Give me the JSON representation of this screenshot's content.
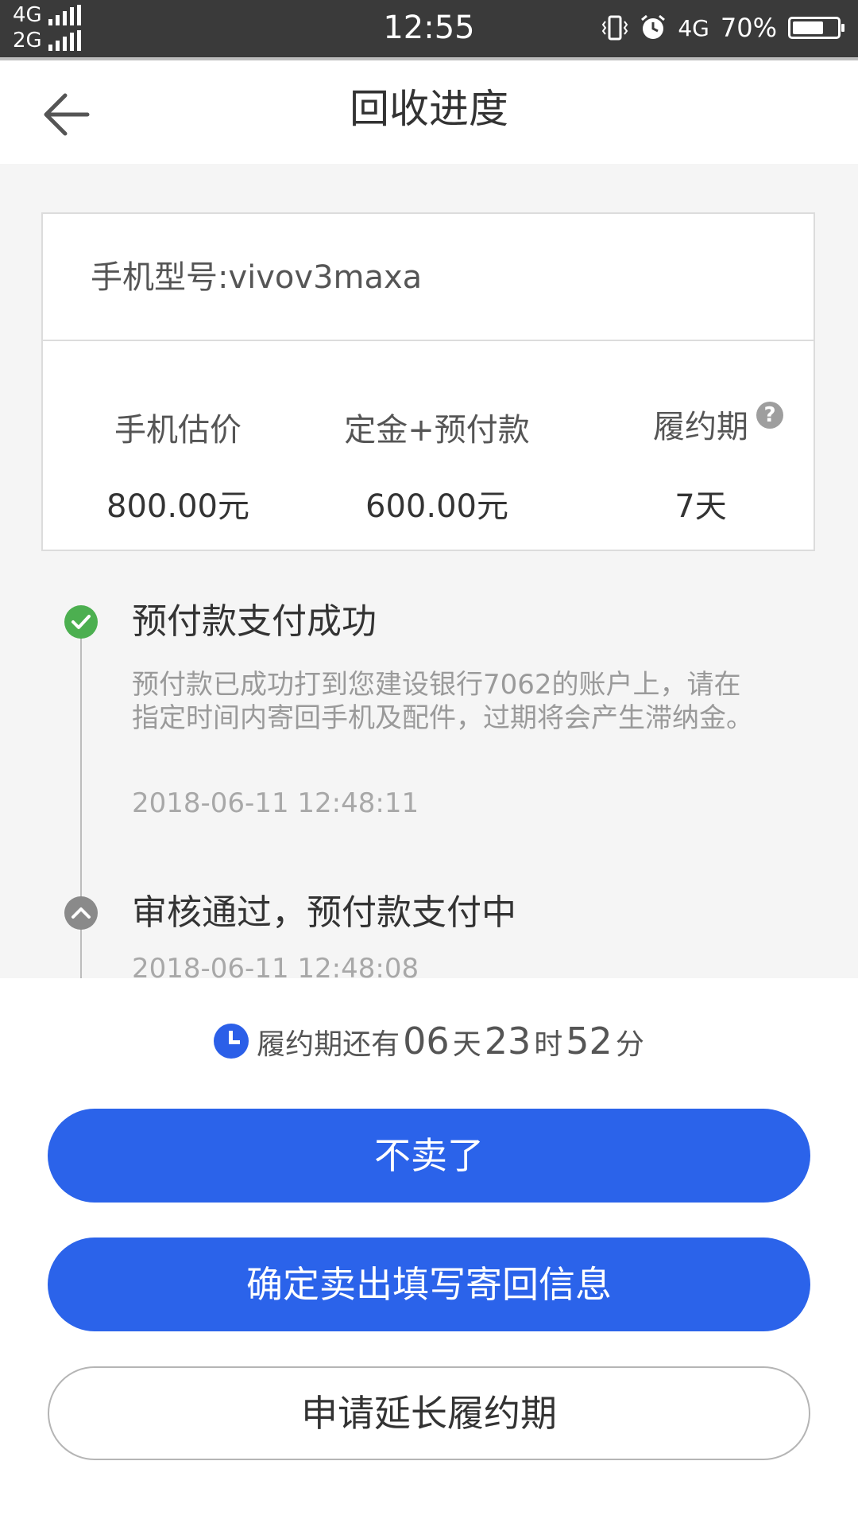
{
  "status_bar": {
    "net_top": "4G",
    "net_bottom": "2G",
    "time": "12:55",
    "network": "4G",
    "battery": "70%",
    "battery_level": 0.7
  },
  "header": {
    "title": "回收进度",
    "back_icon": "arrow-left-icon"
  },
  "card": {
    "model": "手机型号:vivov3maxa",
    "stats": [
      {
        "label": "手机估价",
        "value": "800.00元"
      },
      {
        "label": "定金+预付款",
        "value": "600.00元"
      },
      {
        "label": "履约期",
        "value": "7天"
      }
    ],
    "help_icon_text": "?"
  },
  "timeline": [
    {
      "title": "预付款支付成功",
      "desc": "预付款已成功打到您建设银行7062的账户上，请在指定时间内寄回手机及配件，过期将会产生滞纳金。",
      "time": "2018-06-11 12:48:11",
      "status": "success",
      "color": "#4caf50"
    },
    {
      "title": "审核通过，预付款支付中",
      "desc": "",
      "time": "2018-06-11 12:48:08",
      "status": "collapsed",
      "color": "#8a8a8a"
    }
  ],
  "countdown": {
    "prefix": "履约期还有",
    "days": "06",
    "days_unit": "天",
    "hours": "23",
    "hours_unit": "时",
    "minutes": "52",
    "minutes_unit": "分"
  },
  "buttons": {
    "cancel": "不卖了",
    "confirm": "确定卖出填写寄回信息",
    "extend": "申请延长履约期"
  },
  "colors": {
    "accent": "#2b63ea",
    "success": "#4caf50"
  }
}
